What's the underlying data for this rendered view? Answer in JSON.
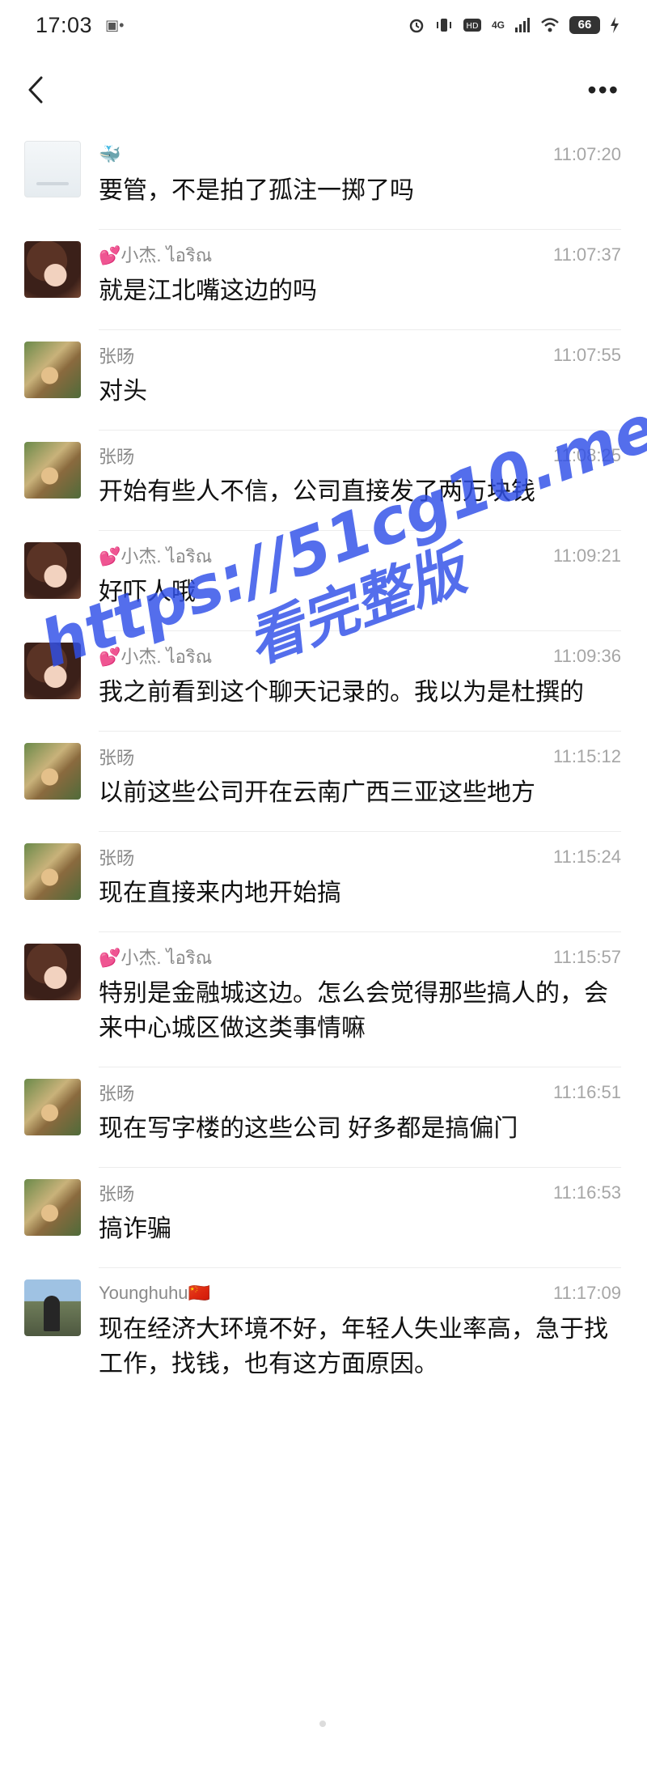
{
  "status_bar": {
    "time": "17:03",
    "left_glyph": "▣•",
    "network": "4G",
    "battery": "66",
    "icons": [
      "alarm-icon",
      "vibrate-icon",
      "hd-icon",
      "signal-icon",
      "wifi-icon",
      "battery-icon",
      "charging-icon"
    ]
  },
  "nav": {
    "back_icon": "chevron-left-icon",
    "more_label": "•••"
  },
  "messages": [
    {
      "name": "🐳",
      "time": "11:07:20",
      "text": "要管，不是拍了孤注一掷了吗",
      "avatar": "placeholder"
    },
    {
      "name": "💕小杰. ไอริณ",
      "time": "11:07:37",
      "text": "就是江北嘴这边的吗",
      "avatar": "girl"
    },
    {
      "name": "张旸",
      "time": "11:07:55",
      "text": "对头",
      "avatar": "zhang"
    },
    {
      "name": "张旸",
      "time": "11:08:25",
      "text": "开始有些人不信，公司直接发了两万块钱",
      "avatar": "zhang"
    },
    {
      "name": "💕小杰. ไอริณ",
      "time": "11:09:21",
      "text": "好吓人哦",
      "avatar": "girl"
    },
    {
      "name": "💕小杰. ไอริณ",
      "time": "11:09:36",
      "text": "我之前看到这个聊天记录的。我以为是杜撰的",
      "avatar": "girl"
    },
    {
      "name": "张旸",
      "time": "11:15:12",
      "text": "以前这些公司开在云南广西三亚这些地方",
      "avatar": "zhang"
    },
    {
      "name": "张旸",
      "time": "11:15:24",
      "text": "现在直接来内地开始搞",
      "avatar": "zhang"
    },
    {
      "name": "💕小杰. ไอริณ",
      "time": "11:15:57",
      "text": "特别是金融城这边。怎么会觉得那些搞人的，会来中心城区做这类事情嘛",
      "avatar": "girl"
    },
    {
      "name": "张旸",
      "time": "11:16:51",
      "text": "现在写字楼的这些公司 好多都是搞偏门",
      "avatar": "zhang"
    },
    {
      "name": "张旸",
      "time": "11:16:53",
      "text": "搞诈骗",
      "avatar": "zhang"
    },
    {
      "name": "Younghuhu🇨🇳",
      "time": "11:17:09",
      "text": "现在经济大环境不好，年轻人失业率高，急于找工作，找钱，也有这方面原因。",
      "avatar": "young"
    }
  ],
  "watermark": {
    "line1": "https://51cg10.me",
    "line2": "看完整版",
    "color": "#2f4fe8"
  }
}
